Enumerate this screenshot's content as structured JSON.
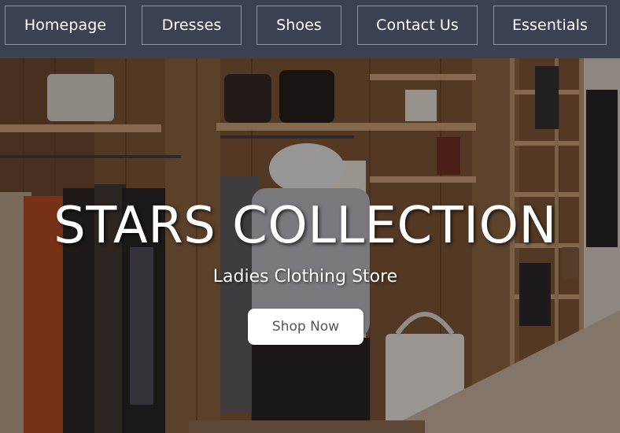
{
  "nav": {
    "items": [
      {
        "label": "Homepage"
      },
      {
        "label": "Dresses"
      },
      {
        "label": "Shoes"
      },
      {
        "label": "Contact Us"
      },
      {
        "label": "Essentials"
      }
    ]
  },
  "hero": {
    "title": "STARS COLLECTION",
    "subtitle": "Ladies Clothing Store",
    "cta_label": "Shop Now"
  },
  "colors": {
    "nav_background": "#3b4150",
    "nav_border": "#8f97a6",
    "button_background": "#ffffff",
    "button_text": "#555555"
  }
}
